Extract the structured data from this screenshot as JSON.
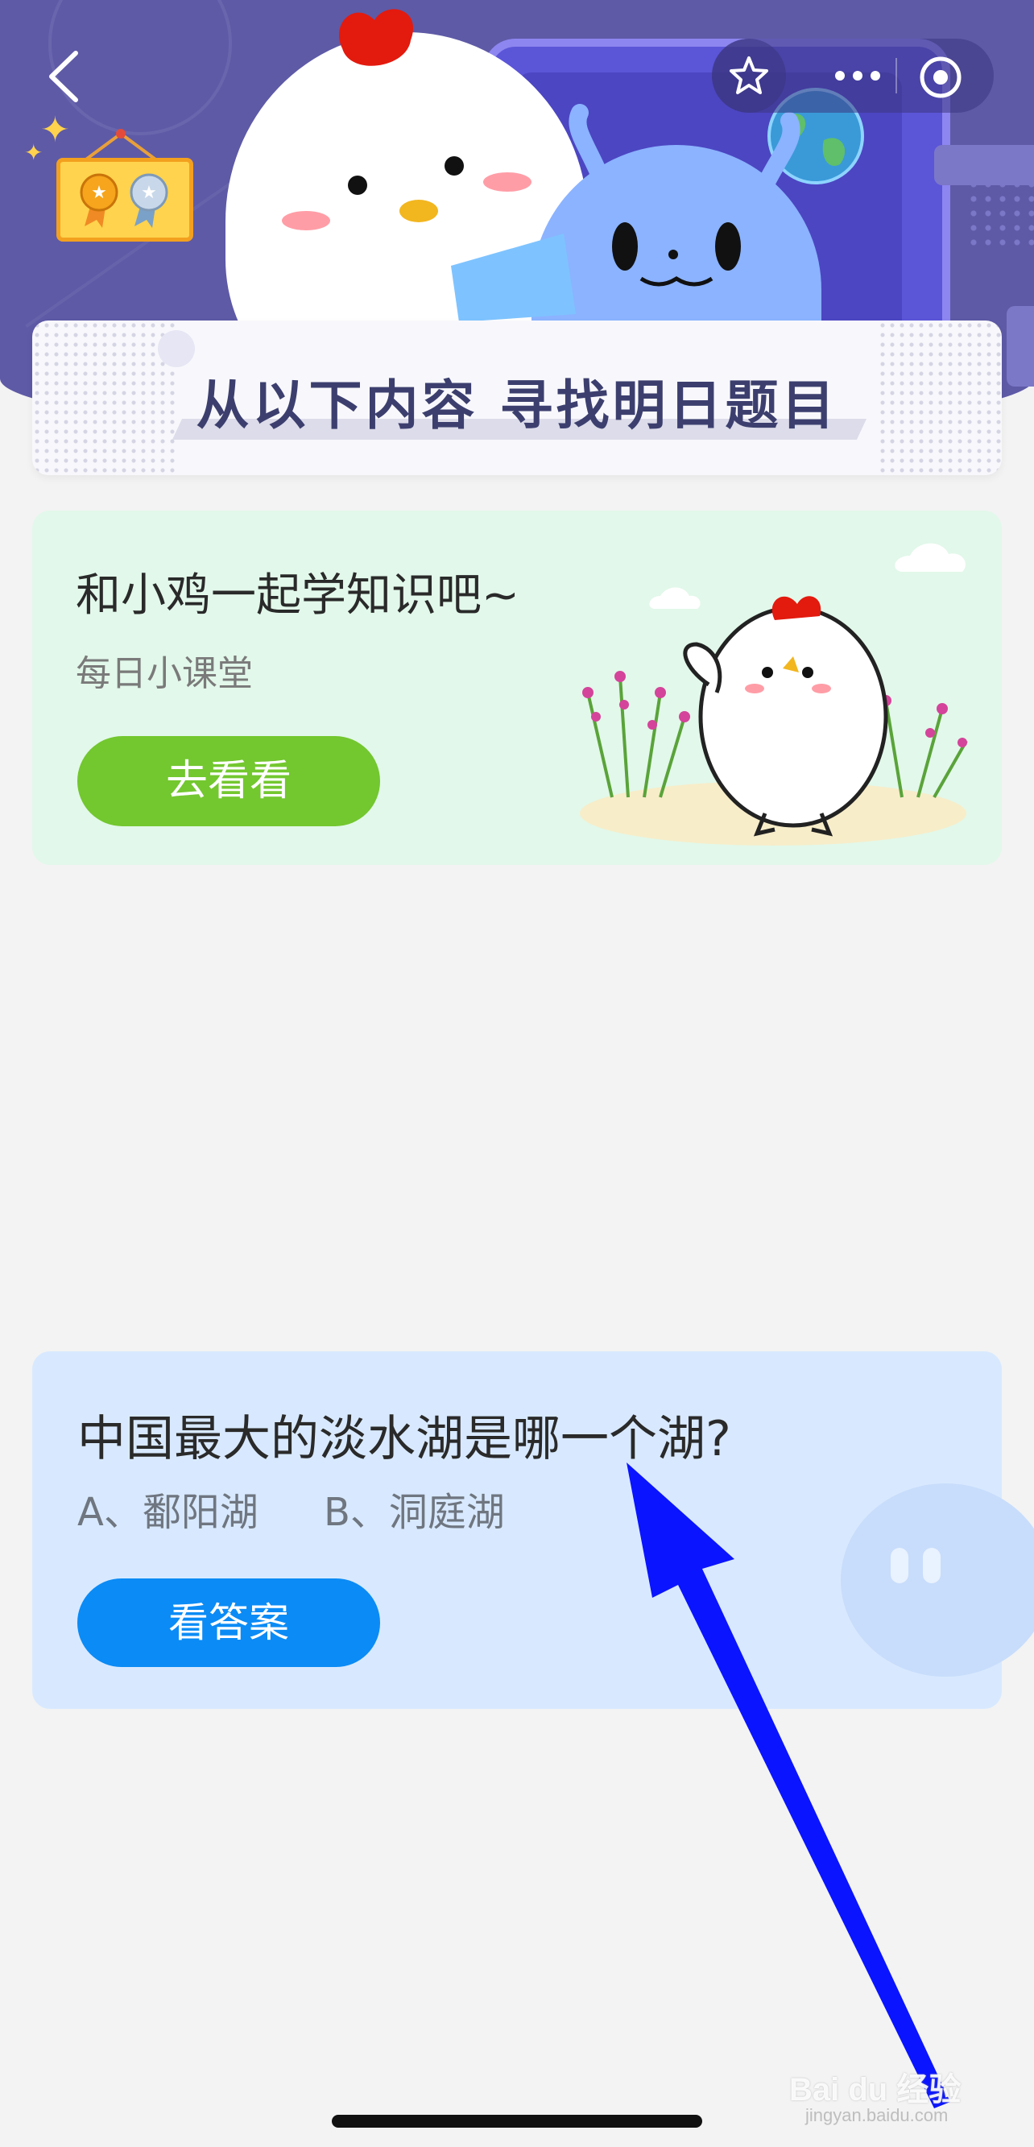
{
  "header": {
    "back_icon": "chevron-left-icon",
    "favorite_icon": "star-icon",
    "more_icon": "more-dots-icon",
    "close_icon": "target-circle-icon",
    "brand_color": "#5e5aa6"
  },
  "banner": {
    "title": "从以下内容  寻找明日题目"
  },
  "lesson_card": {
    "title": "和小鸡一起学知识吧~",
    "subtitle": "每日小课堂",
    "button_label": "去看看",
    "background": "#e2f8ea",
    "button_color": "#73c72f"
  },
  "quiz_card": {
    "question": "中国最大的淡水湖是哪一个湖?",
    "option_a": "A、鄱阳湖",
    "option_b": "B、洞庭湖",
    "button_label": "看答案",
    "background": "#d8e9ff",
    "button_color": "#0b8bf5"
  },
  "watermark": {
    "brand": "Bai du 经验",
    "url": "jingyan.baidu.com"
  }
}
